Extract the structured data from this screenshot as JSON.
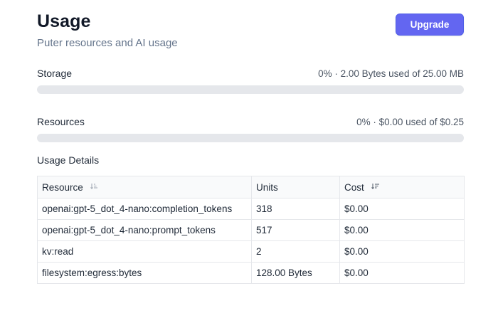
{
  "header": {
    "title": "Usage",
    "subtitle": "Puter resources and AI usage",
    "upgrade_label": "Upgrade"
  },
  "storage": {
    "label": "Storage",
    "summary": "0% · 2.00 Bytes used of 25.00 MB",
    "percent": 0
  },
  "resources": {
    "label": "Resources",
    "summary": "0% · $0.00 used of $0.25",
    "percent": 0
  },
  "details": {
    "title": "Usage Details",
    "columns": {
      "resource": "Resource",
      "units": "Units",
      "cost": "Cost"
    },
    "rows": [
      {
        "resource": "openai:gpt-5_dot_4-nano:completion_tokens",
        "units": "318",
        "cost": "$0.00"
      },
      {
        "resource": "openai:gpt-5_dot_4-nano:prompt_tokens",
        "units": "517",
        "cost": "$0.00"
      },
      {
        "resource": "kv:read",
        "units": "2",
        "cost": "$0.00"
      },
      {
        "resource": "filesystem:egress:bytes",
        "units": "128.00 Bytes",
        "cost": "$0.00"
      }
    ]
  },
  "icons": {
    "resource_sort": "sort-ascending-icon",
    "cost_sort": "sort-descending-icon"
  },
  "colors": {
    "accent": "#6366f1",
    "bar_track": "#e5e7eb"
  }
}
